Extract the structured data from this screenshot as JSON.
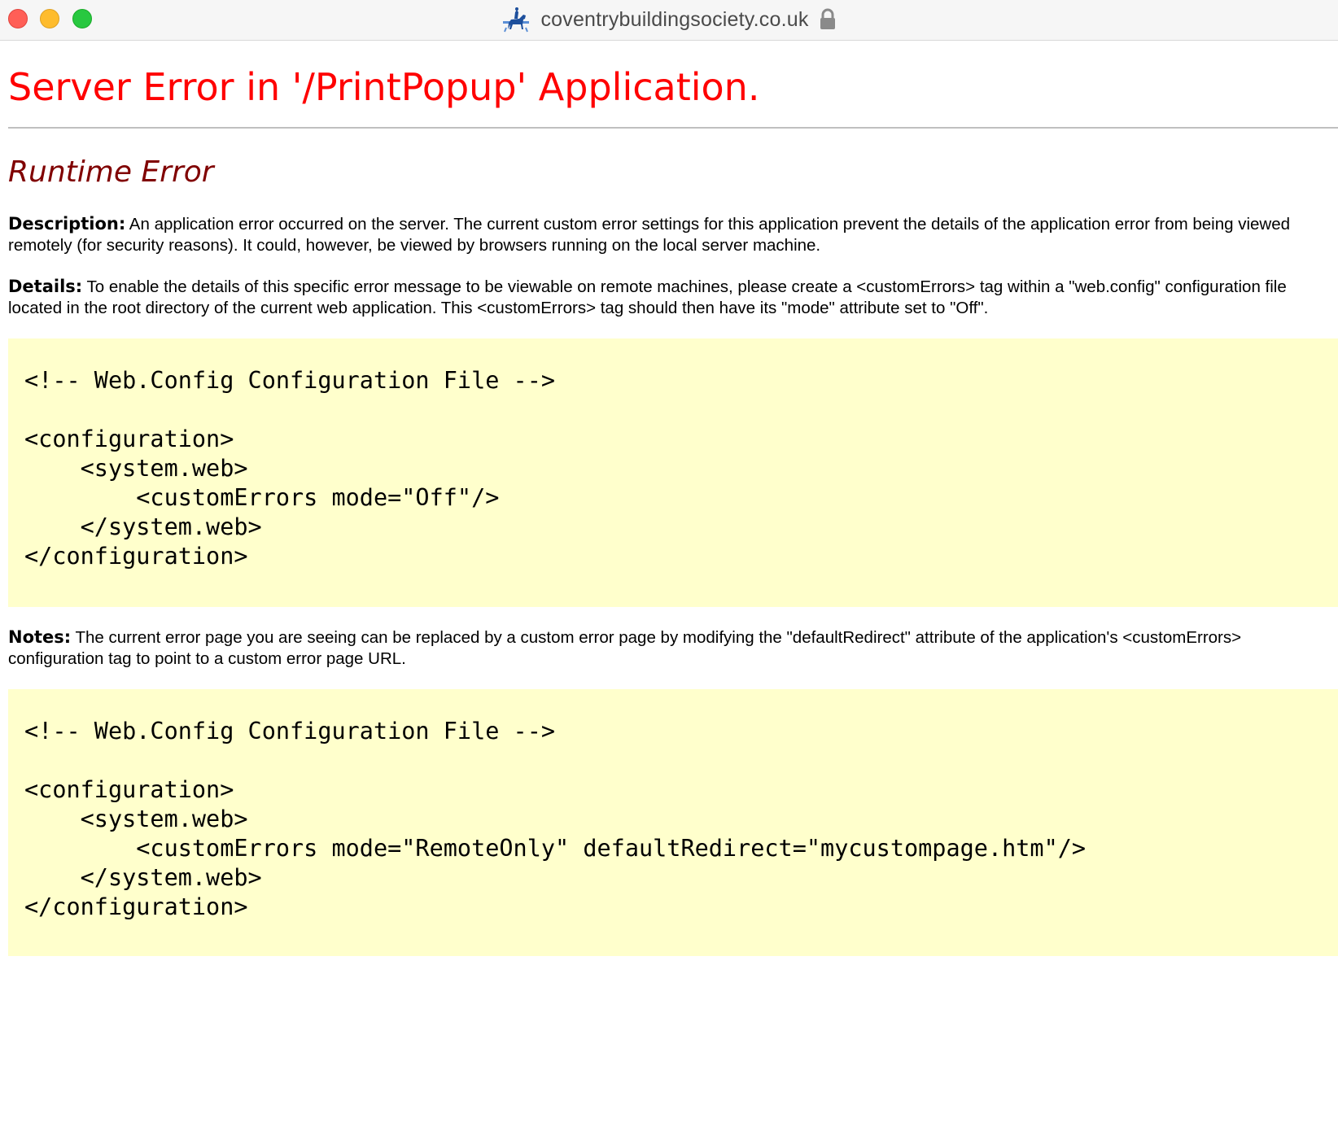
{
  "browser": {
    "url": "coventrybuildingsociety.co.uk",
    "site_icon": "horse-rider-logo-icon",
    "lock_icon": "lock-icon"
  },
  "page": {
    "title": "Server Error in '/PrintPopup' Application.",
    "subtitle": "Runtime Error",
    "description": {
      "label": "Description:",
      "text": " An application error occurred on the server. The current custom error settings for this application prevent the details of the application error from being viewed remotely (for security reasons). It could, however, be viewed by browsers running on the local server machine."
    },
    "details": {
      "label": "Details:",
      "text": " To enable the details of this specific error message to be viewable on remote machines, please create a <customErrors> tag within a \"web.config\" configuration file located in the root directory of the current web application. This <customErrors> tag should then have its \"mode\" attribute set to \"Off\"."
    },
    "code1": "<!-- Web.Config Configuration File -->\n\n<configuration>\n    <system.web>\n        <customErrors mode=\"Off\"/>\n    </system.web>\n</configuration>",
    "notes": {
      "label": "Notes:",
      "text": " The current error page you are seeing can be replaced by a custom error page by modifying the \"defaultRedirect\" attribute of the application's <customErrors> configuration tag to point to a custom error page URL."
    },
    "code2": "<!-- Web.Config Configuration File -->\n\n<configuration>\n    <system.web>\n        <customErrors mode=\"RemoteOnly\" defaultRedirect=\"mycustompage.htm\"/>\n    </system.web>\n</configuration>"
  },
  "colors": {
    "title": "#ff0000",
    "subtitle": "#800000",
    "code_background": "#ffffcc"
  }
}
